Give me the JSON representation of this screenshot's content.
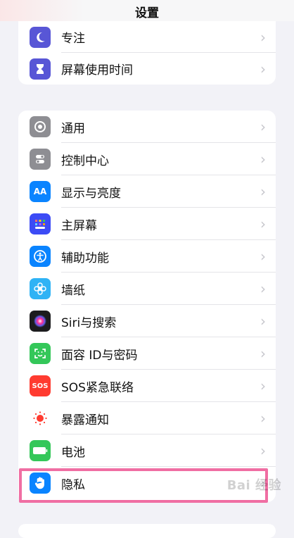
{
  "header": {
    "title": "设置"
  },
  "group1": {
    "items": [
      {
        "label": "专注",
        "icon": "moon-icon",
        "icon_color": "#5856d6"
      },
      {
        "label": "屏幕使用时间",
        "icon": "hourglass-icon",
        "icon_color": "#5856d6"
      }
    ]
  },
  "group2": {
    "items": [
      {
        "label": "通用",
        "icon": "gear-icon",
        "icon_color": "#8e8e93"
      },
      {
        "label": "控制中心",
        "icon": "switches-icon",
        "icon_color": "#8e8e93"
      },
      {
        "label": "显示与亮度",
        "icon": "text-size-icon",
        "icon_text": "AA",
        "icon_color": "#0a84ff"
      },
      {
        "label": "主屏幕",
        "icon": "app-grid-icon",
        "icon_color": "#3c4bf5"
      },
      {
        "label": "辅助功能",
        "icon": "accessibility-icon",
        "icon_color": "#0a84ff"
      },
      {
        "label": "墙纸",
        "icon": "flower-icon",
        "icon_color": "#2fb3f5"
      },
      {
        "label": "Siri与搜索",
        "icon": "siri-icon",
        "icon_color": "#1c1c1e"
      },
      {
        "label": "面容 ID与密码",
        "icon": "face-id-icon",
        "icon_color": "#34c759"
      },
      {
        "label": "SOS紧急联络",
        "icon": "sos-icon",
        "icon_text": "SOS",
        "icon_color": "#ff3b30"
      },
      {
        "label": "暴露通知",
        "icon": "exposure-icon",
        "icon_color": "#ffffff"
      },
      {
        "label": "电池",
        "icon": "battery-icon",
        "icon_color": "#34c759"
      },
      {
        "label": "隐私",
        "icon": "hand-icon",
        "icon_color": "#0a84ff"
      }
    ]
  },
  "chevron": "›",
  "watermark": "Bai 经验"
}
